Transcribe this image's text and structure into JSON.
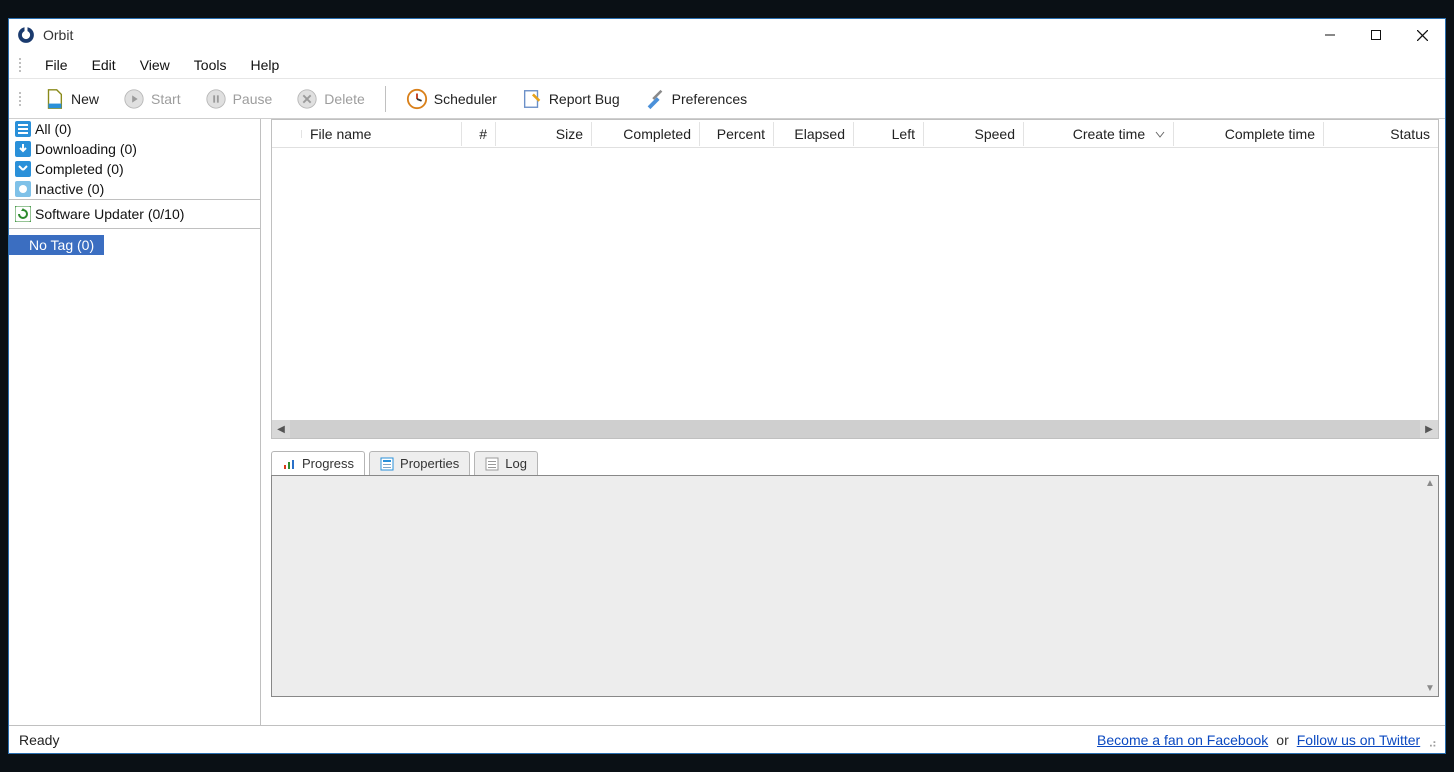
{
  "window": {
    "title": "Orbit"
  },
  "menu": {
    "items": [
      "File",
      "Edit",
      "View",
      "Tools",
      "Help"
    ]
  },
  "toolbar": {
    "new": "New",
    "start": "Start",
    "pause": "Pause",
    "delete": "Delete",
    "scheduler": "Scheduler",
    "report_bug": "Report Bug",
    "preferences": "Preferences"
  },
  "sidebar": {
    "group1": [
      {
        "label": "All (0)",
        "icon": "list"
      },
      {
        "label": "Downloading (0)",
        "icon": "down"
      },
      {
        "label": "Completed (0)",
        "icon": "done"
      },
      {
        "label": "Inactive (0)",
        "icon": "idle"
      }
    ],
    "group2": [
      {
        "label": "Software Updater (0/10)",
        "icon": "upd"
      }
    ],
    "group3": [
      {
        "label": "No Tag (0)"
      }
    ]
  },
  "columns": [
    "File name",
    "#",
    "Size",
    "Completed",
    "Percent",
    "Elapsed",
    "Left",
    "Speed",
    "Create time",
    "Complete time",
    "Status"
  ],
  "sorted_column": "Create time",
  "tabs": {
    "progress": "Progress",
    "properties": "Properties",
    "log": "Log"
  },
  "statusbar": {
    "ready": "Ready",
    "facebook": "Become a fan on Facebook",
    "or": "or",
    "twitter": "Follow us on Twitter"
  }
}
